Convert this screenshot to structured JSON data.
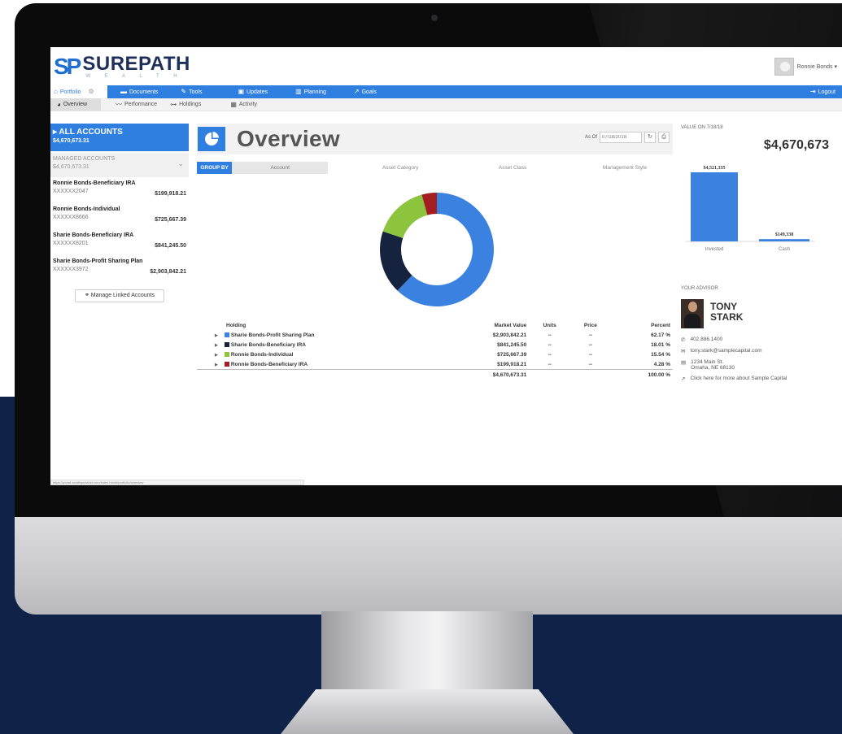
{
  "brand": {
    "logo_mark": "SP",
    "name": "SUREPATH",
    "tagline": "W E A L T H"
  },
  "user": {
    "name": "Ronnie Bonds ▾"
  },
  "nav": {
    "portfolio": "Portfolio",
    "documents": "Documents",
    "tools": "Tools",
    "updates": "Updates",
    "planning": "Planning",
    "goals": "Goals",
    "logout": "Logout"
  },
  "subnav": {
    "overview": "Overview",
    "performance": "Performance",
    "holdings": "Holdings",
    "activity": "Activity"
  },
  "sidebar": {
    "all_accounts_title": "▸ ALL ACCOUNTS",
    "all_accounts_value": "$4,670,673.31",
    "managed_title": "MANAGED ACCOUNTS",
    "managed_value": "$4,670,673.31",
    "accounts": [
      {
        "name": "Ronnie Bonds-Beneficiary IRA",
        "number": "XXXXXX2047",
        "balance": "$199,918.21"
      },
      {
        "name": "Ronnie Bonds-Individual",
        "number": "XXXXXX8666",
        "balance": "$725,667.39"
      },
      {
        "name": "Sharie Bonds-Beneficiary IRA",
        "number": "XXXXXX8201",
        "balance": "$841,245.50"
      },
      {
        "name": "Sharie Bonds-Profit Sharing Plan",
        "number": "XXXXXX3972",
        "balance": "$2,903,842.21"
      }
    ],
    "manage_button": "Manage Linked Accounts"
  },
  "overview": {
    "title": "Overview",
    "as_of_label": "As Of",
    "as_of_value": "07/18/2018",
    "group_by_label": "GROUP BY",
    "group_tabs": [
      "Account",
      "Asset Category",
      "Asset Class",
      "Management Style"
    ]
  },
  "holdings": {
    "headers": {
      "holding": "Holding",
      "market_value": "Market Value",
      "units": "Units",
      "price": "Price",
      "percent": "Percent"
    },
    "rows": [
      {
        "name": "Sharie Bonds-Profit Sharing Plan",
        "market_value": "$2,903,842.21",
        "units": "--",
        "price": "--",
        "percent": "62.17 %",
        "color": "#3b82e0"
      },
      {
        "name": "Sharie Bonds-Beneficiary IRA",
        "market_value": "$841,245.50",
        "units": "--",
        "price": "--",
        "percent": "18.01 %",
        "color": "#16233f"
      },
      {
        "name": "Ronnie Bonds-Individual",
        "market_value": "$725,667.39",
        "units": "--",
        "price": "--",
        "percent": "15.54 %",
        "color": "#8dc43e"
      },
      {
        "name": "Ronnie Bonds-Beneficiary IRA",
        "market_value": "$199,918.21",
        "units": "--",
        "price": "--",
        "percent": "4.28 %",
        "color": "#a31e22"
      }
    ],
    "total_value": "$4,670,673.31",
    "total_percent": "100.00 %"
  },
  "chart_data": [
    {
      "type": "pie",
      "categories": [
        "Sharie Bonds-Profit Sharing Plan",
        "Sharie Bonds-Beneficiary IRA",
        "Ronnie Bonds-Individual",
        "Ronnie Bonds-Beneficiary IRA"
      ],
      "values": [
        62.17,
        18.01,
        15.54,
        4.28
      ],
      "colors": [
        "#3b82e0",
        "#16233f",
        "#8dc43e",
        "#a31e22"
      ]
    },
    {
      "type": "bar",
      "categories": [
        "Invested",
        "Cash"
      ],
      "values": [
        4521335,
        149338
      ],
      "labels": [
        "$4,521,335",
        "$149,338"
      ],
      "color": "#3b82e0"
    }
  ],
  "value_panel": {
    "label": "VALUE ON 7/18/18",
    "value": "$4,670,673"
  },
  "advisor": {
    "label": "YOUR ADVISOR",
    "first_name": "TONY",
    "last_name": "STARK",
    "phone": "402.886.1400",
    "email": "tony.stark@samplecapital.com",
    "address_line1": "1234 Main St.",
    "address_line2": "Omaha, NE 68130",
    "more_link": "Click here for more about Sample Capital"
  },
  "status_url": "https://portal.wealthprovider.com/index.html#/portfolio/overview"
}
